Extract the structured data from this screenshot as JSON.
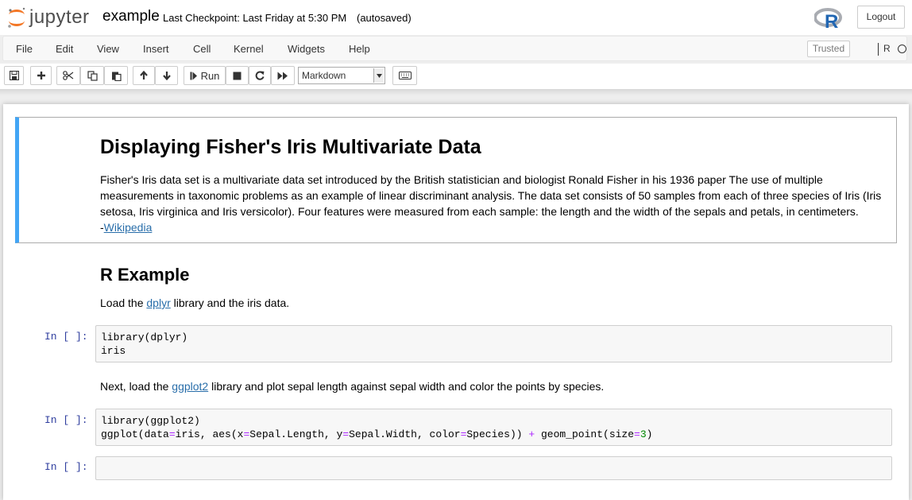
{
  "header": {
    "logo_text": "jupyter",
    "notebook_name": "example",
    "checkpoint": "Last Checkpoint: Last Friday at 5:30 PM",
    "autosave": "(autosaved)",
    "kernel_logo_letter": "R",
    "logout_label": "Logout"
  },
  "menubar": {
    "items": [
      "File",
      "Edit",
      "View",
      "Insert",
      "Cell",
      "Kernel",
      "Widgets",
      "Help"
    ],
    "trusted_label": "Trusted",
    "kernel_name": "R"
  },
  "toolbar": {
    "run_label": "Run",
    "cell_type": "Markdown"
  },
  "cells": {
    "intro": {
      "title": "Displaying Fisher's Iris Multivariate Data",
      "line1": "Fisher's Iris data set is a multivariate data set introduced by the British statistician and biologist Ronald Fisher in his 1936 paper The use of multiple",
      "line2": "measurements in taxonomic problems as an example of linear discriminant analysis. The data set consists of 50 samples from each of three species of Iris (Iris",
      "line3": "setosa, Iris virginica and Iris versicolor). Four features were measured from each sample: the length and the width of the sepals and petals, in centimeters.",
      "dash": "-",
      "link": "Wikipedia"
    },
    "r_example": {
      "heading": "R Example",
      "text_before": "Load the ",
      "link": "dplyr",
      "text_after": " library and the iris data."
    },
    "code1": {
      "prompt": "In [ ]:",
      "line1": "library(dplyr)",
      "line2": "iris"
    },
    "next_text": {
      "text_before": "Next, load the ",
      "link": "ggplot2",
      "text_after": " library and plot sepal length against sepal width and color the points by species."
    },
    "code2": {
      "prompt": "In [ ]:",
      "line1": "library(ggplot2)",
      "l2_a": "ggplot(data",
      "op": "=",
      "l2_b": "iris, aes(x",
      "l2_c": "Sepal.Length, y",
      "l2_d": "Sepal.Width, color",
      "l2_e": "Species)) ",
      "plus": "+",
      "l2_f": " geom_point(size",
      "num": "3",
      "l2_g": ")"
    },
    "code3": {
      "prompt": "In [ ]:"
    }
  }
}
